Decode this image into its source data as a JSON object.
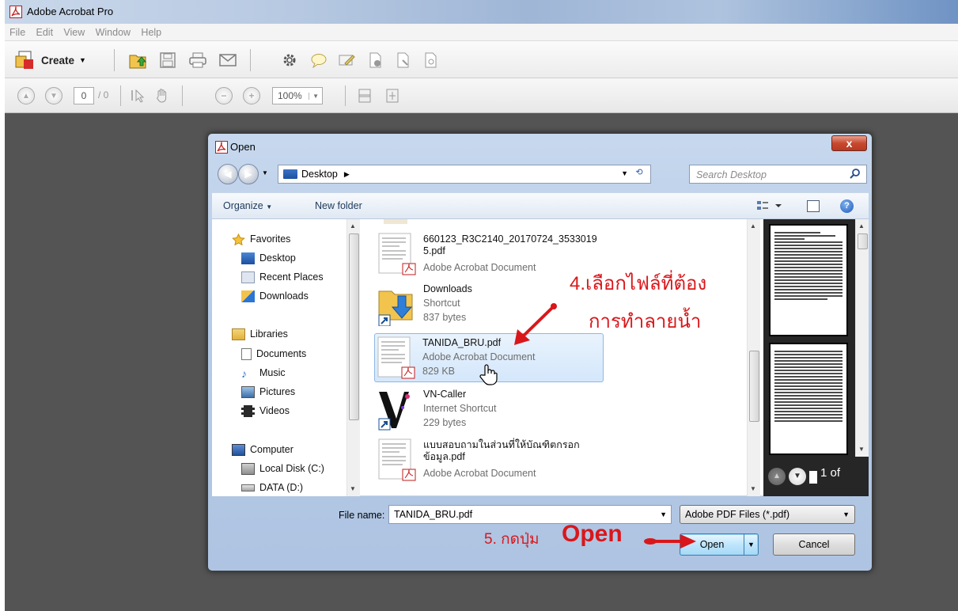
{
  "app": {
    "title": "Adobe Acrobat Pro",
    "menu": [
      "File",
      "Edit",
      "View",
      "Window",
      "Help"
    ],
    "create_label": "Create",
    "page_current": "0",
    "page_total": "/ 0",
    "zoom": "100%"
  },
  "dialog": {
    "title": "Open",
    "close_label": "x",
    "location": "Desktop",
    "search_placeholder": "Search Desktop",
    "organize_label": "Organize",
    "new_folder_label": "New folder",
    "help_label": "?",
    "nav": {
      "favorites": "Favorites",
      "desktop": "Desktop",
      "recent": "Recent Places",
      "downloads": "Downloads",
      "libraries": "Libraries",
      "documents": "Documents",
      "music": "Music",
      "pictures": "Pictures",
      "videos": "Videos",
      "computer": "Computer",
      "local_disk": "Local Disk (C:)",
      "data": "DATA (D:)"
    },
    "files": [
      {
        "name_line1": "660123_R3C2140_20170724_3533019",
        "name_line2": "5.pdf",
        "type": "Adobe Acrobat Document"
      },
      {
        "name": "Downloads",
        "type": "Shortcut",
        "size": "837 bytes"
      },
      {
        "name": "TANIDA_BRU.pdf",
        "type": "Adobe Acrobat Document",
        "size": "829 KB"
      },
      {
        "name": "VN-Caller",
        "type": "Internet Shortcut",
        "size": "229 bytes"
      },
      {
        "name_line1": "แบบสอบถามในส่วนที่ให้บัณฑิตกรอก",
        "name_line2": "ข้อมูล.pdf",
        "type": "Adobe Acrobat Document"
      }
    ],
    "preview_page": "1 of",
    "file_name_label": "File name:",
    "file_name_value": "TANIDA_BRU.pdf",
    "file_type": "Adobe PDF Files (*.pdf)",
    "open_label": "Open",
    "cancel_label": "Cancel"
  },
  "annotations": {
    "step4_line1": "4.เลือกไฟล์ที่ต้อง",
    "step4_line2": "การทำลายน้ำ",
    "step5_prefix": "5. กดปุ่ม",
    "step5_word": "Open"
  },
  "colors": {
    "annotation": "#d9171b",
    "workspace": "#545454",
    "dialog_frame": "#b6cbe6"
  }
}
